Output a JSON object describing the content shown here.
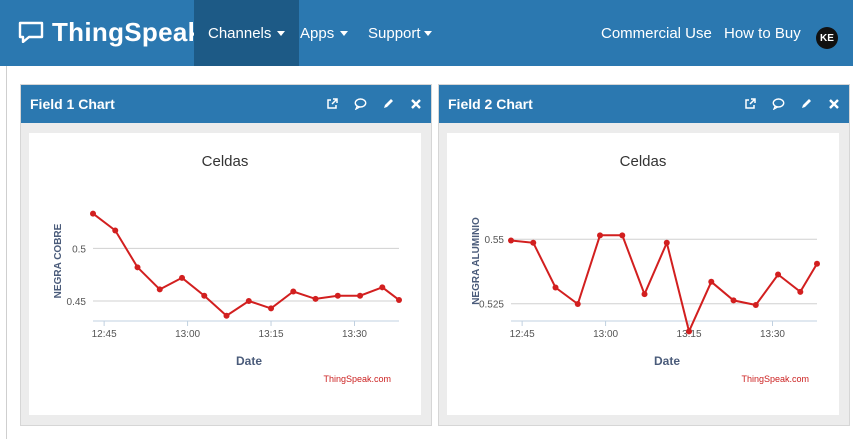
{
  "navbar": {
    "brand": "ThingSpeak",
    "brand_tm": "™",
    "items": [
      {
        "label": "Channels",
        "dropdown": true,
        "active": true
      },
      {
        "label": "Apps",
        "dropdown": true
      },
      {
        "label": "Support",
        "dropdown": true
      },
      {
        "label": "Commercial Use"
      },
      {
        "label": "How to Buy"
      }
    ],
    "avatar": "KE",
    "color": "#2b78b0"
  },
  "panels": [
    {
      "title": "Field 1 Chart",
      "tools": [
        "external-link-icon",
        "comment-icon",
        "pencil-icon",
        "close-icon"
      ]
    },
    {
      "title": "Field 2 Chart",
      "tools": [
        "external-link-icon",
        "comment-icon",
        "pencil-icon",
        "close-icon"
      ]
    }
  ],
  "chart_data": [
    {
      "type": "line",
      "title": "Celdas",
      "xlabel": "Date",
      "ylabel": "NEGRA COBRE",
      "credit": "ThingSpeak.com",
      "xticks": [
        "12:45",
        "13:00",
        "13:15",
        "13:30"
      ],
      "xtick_minutes": [
        45,
        60,
        75,
        90
      ],
      "yticks": [
        0.45,
        0.5
      ],
      "ylim": [
        0.431,
        0.545
      ],
      "xlim_minutes": [
        43,
        98
      ],
      "line_color": "#d21f1f",
      "x_minutes": [
        43,
        47,
        51,
        55,
        59,
        63,
        67,
        71,
        75,
        79,
        83,
        87,
        91,
        95,
        98
      ],
      "values": [
        0.533,
        0.517,
        0.482,
        0.461,
        0.472,
        0.455,
        0.436,
        0.45,
        0.443,
        0.459,
        0.452,
        0.455,
        0.455,
        0.463,
        0.451
      ]
    },
    {
      "type": "line",
      "title": "Celdas",
      "xlabel": "Date",
      "ylabel": "NEGRA ALUMINIO",
      "credit": "ThingSpeak.com",
      "xticks": [
        "12:45",
        "13:00",
        "13:15",
        "13:30"
      ],
      "xtick_minutes": [
        45,
        60,
        75,
        90
      ],
      "yticks": [
        0.525,
        0.55
      ],
      "ylim": [
        0.5183,
        0.5648
      ],
      "xlim_minutes": [
        43,
        98
      ],
      "line_color": "#d21f1f",
      "x_minutes": [
        43,
        47,
        51,
        55,
        59,
        63,
        67,
        71,
        75,
        79,
        83,
        87,
        91,
        95,
        98
      ],
      "values": [
        0.5495,
        0.5486,
        0.5313,
        0.5249,
        0.5515,
        0.5515,
        0.5287,
        0.5486,
        0.5143,
        0.5335,
        0.5263,
        0.5245,
        0.5363,
        0.5296,
        0.5405
      ]
    }
  ]
}
